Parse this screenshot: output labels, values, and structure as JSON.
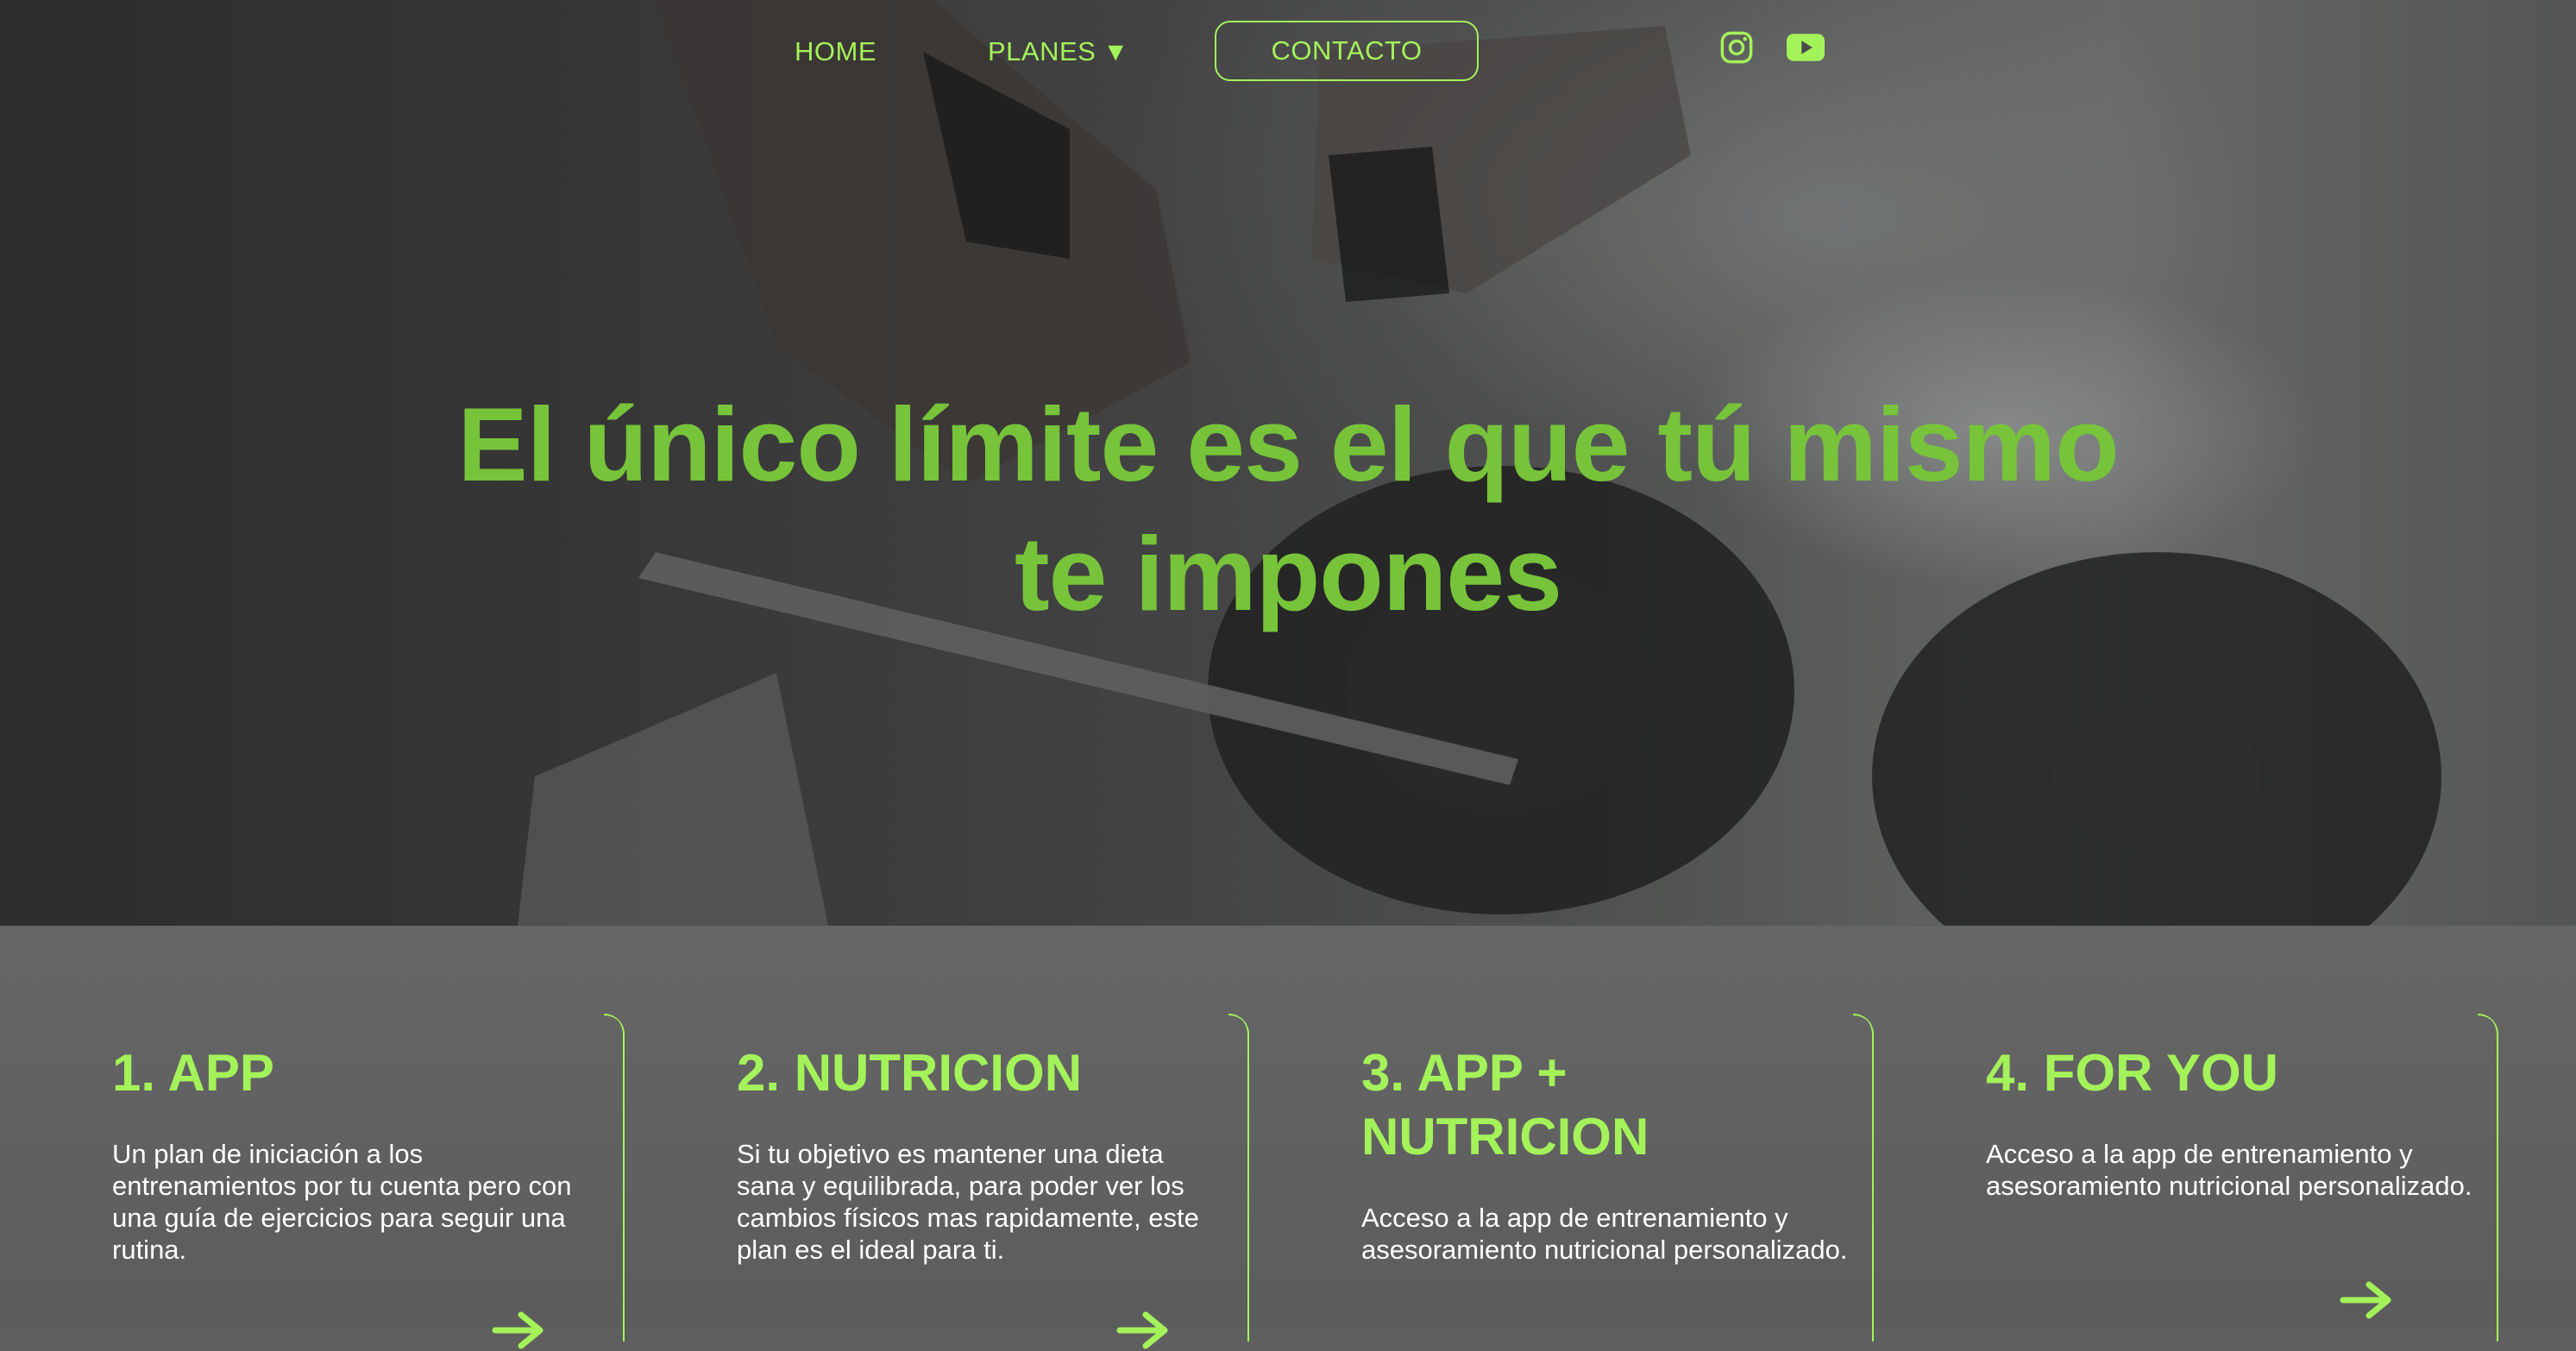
{
  "nav": {
    "home": "HOME",
    "planes": "PLANES",
    "planes_caret": "▼",
    "contact": "CONTACTO"
  },
  "social": [
    {
      "icon": "instagram-icon"
    },
    {
      "icon": "youtube-icon"
    }
  ],
  "hero": {
    "headline_line1": "El único límite es el que tú mismo",
    "headline_line2": "te impones"
  },
  "plans": [
    {
      "title": "1. APP",
      "text": "Un plan de iniciación a los entrenamientos por tu cuenta pero con una guía de ejercicios para seguir una rutina."
    },
    {
      "title": "2. NUTRICION",
      "text": "Si tu objetivo es mantener una dieta sana y equilibrada, para poder ver los cambios físicos mas rapidamente, este plan es el ideal para ti."
    },
    {
      "title": "3. APP + NUTRICION",
      "text": "Acceso a la app de entrenamiento y asesoramiento nutricional personalizado."
    },
    {
      "title": "4. FOR YOU",
      "text": "Acceso a la app de entrenamiento y asesoramiento nutricional personalizado."
    }
  ],
  "colors": {
    "accent": "#a4f25a",
    "headline": "#77c43b",
    "plans_bg": "#666666"
  }
}
